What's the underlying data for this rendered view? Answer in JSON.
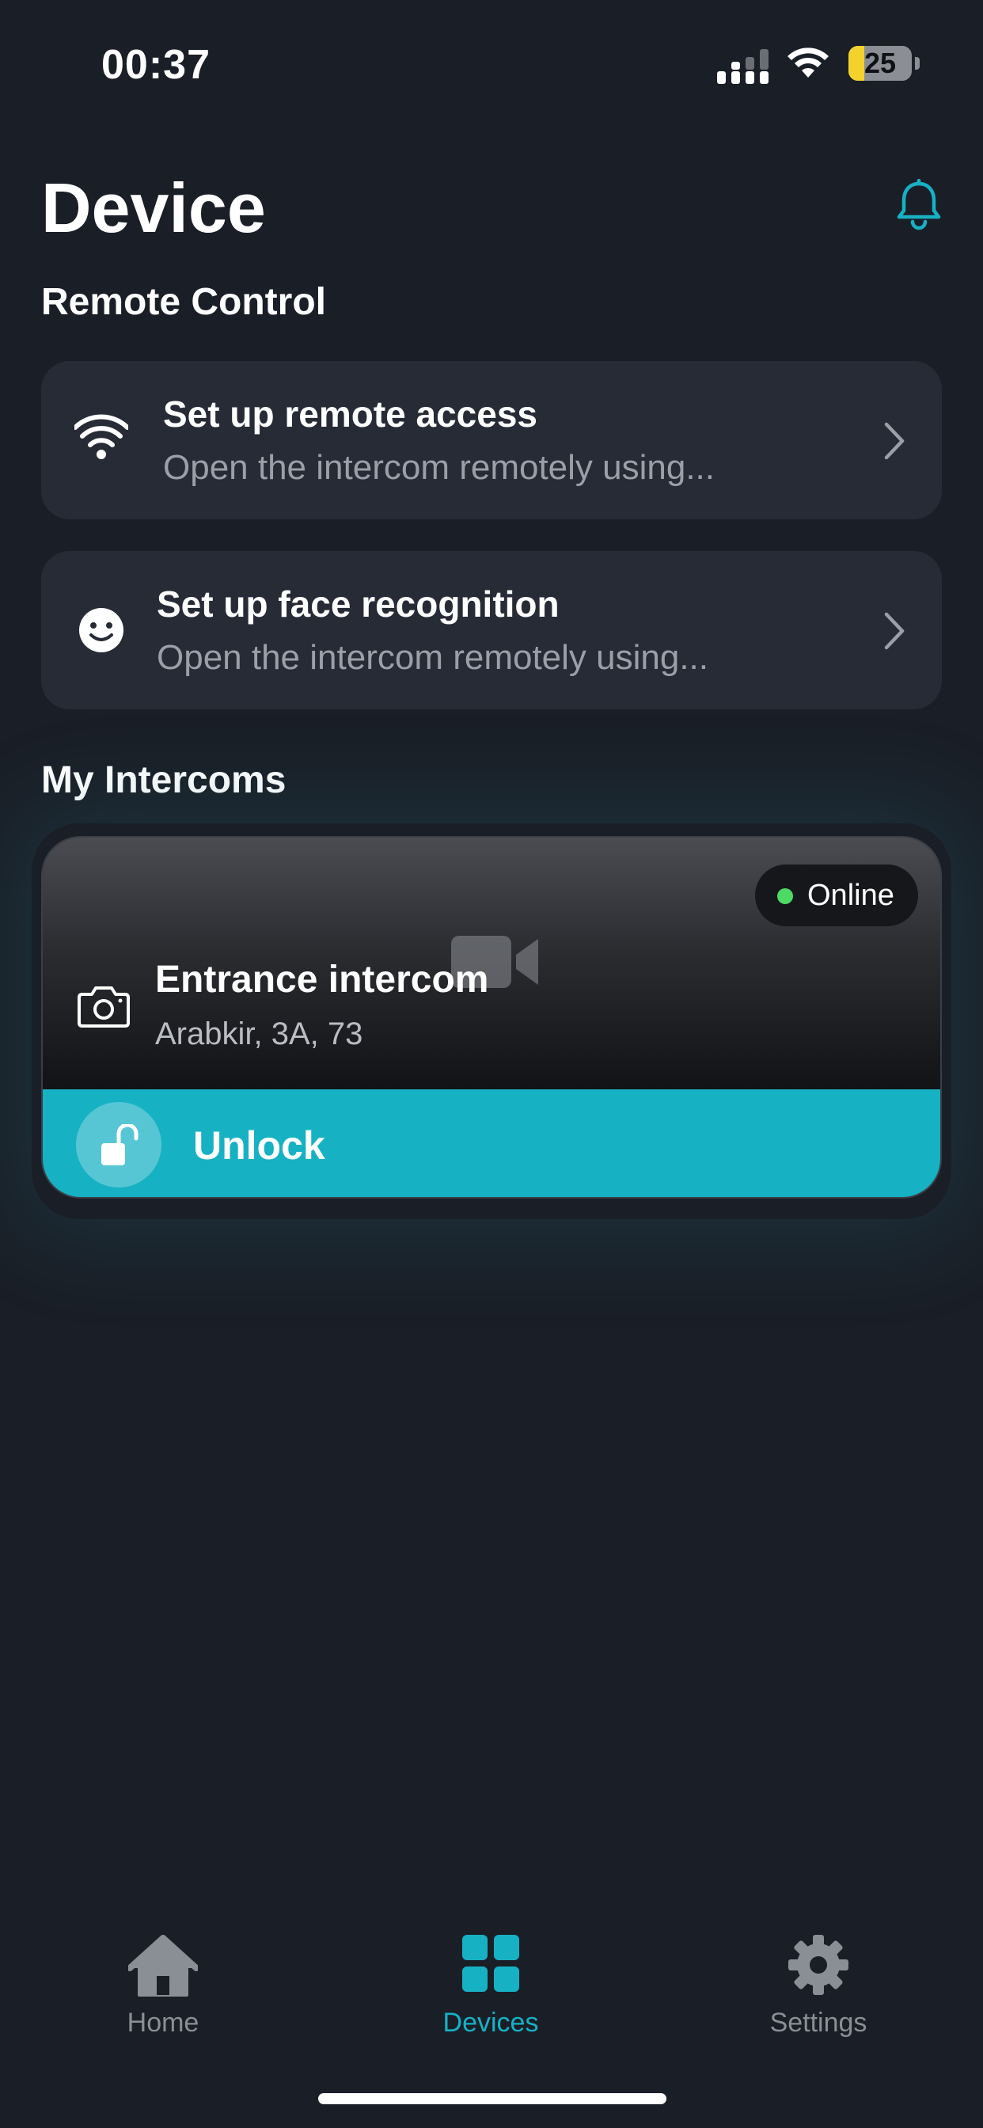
{
  "status_bar": {
    "time": "00:37",
    "battery_level": "25",
    "battery_fraction": 0.25
  },
  "header": {
    "title": "Device",
    "bell_icon": "bell-icon"
  },
  "remote_control": {
    "section_title": "Remote Control",
    "items": [
      {
        "icon": "wifi-icon",
        "title": "Set up remote access",
        "subtitle": "Open the intercom remotely using..."
      },
      {
        "icon": "smiley-face-icon",
        "title": "Set up face recognition",
        "subtitle": "Open the intercom remotely using..."
      }
    ]
  },
  "my_intercoms": {
    "section_title": "My Intercoms",
    "intercom": {
      "status": "Online",
      "status_color": "#4cd964",
      "name": "Entrance intercom",
      "address": "Arabkir, 3A, 73",
      "unlock_label": "Unlock"
    }
  },
  "tab_bar": {
    "items": [
      {
        "label": "Home",
        "icon": "house-icon",
        "active": false
      },
      {
        "label": "Devices",
        "icon": "grid-icon",
        "active": true
      },
      {
        "label": "Settings",
        "icon": "gear-icon",
        "active": false
      }
    ],
    "active_color": "#17b1c4",
    "inactive_color": "#8a8e95"
  },
  "colors": {
    "background": "#1a1f27",
    "card": "#262b35",
    "accent": "#17b1c4"
  }
}
